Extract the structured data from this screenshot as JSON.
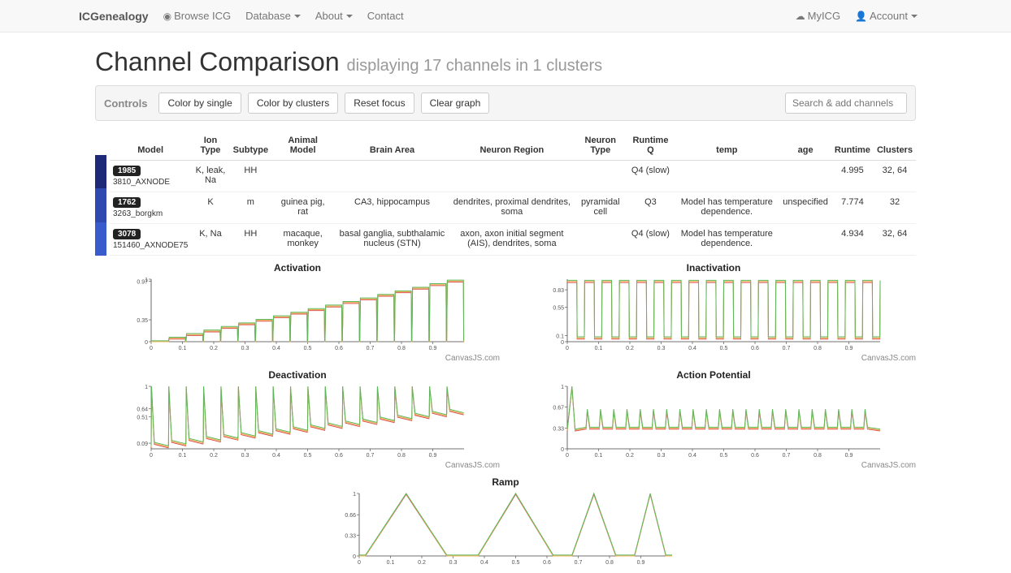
{
  "nav": {
    "brand": "ICGenealogy",
    "browse": "Browse ICG",
    "database": "Database",
    "about": "About",
    "contact": "Contact",
    "myicg": "MyICG",
    "account": "Account"
  },
  "title": "Channel Comparison",
  "subtitle": "displaying 17 channels in 1 clusters",
  "controls": {
    "label": "Controls",
    "color_single": "Color by single",
    "color_clusters": "Color by clusters",
    "reset": "Reset focus",
    "clear": "Clear graph",
    "search_placeholder": "Search & add channels"
  },
  "table": {
    "headers": [
      "Model",
      "Ion Type",
      "Subtype",
      "Animal Model",
      "Brain Area",
      "Neuron Region",
      "Neuron Type",
      "Runtime Q",
      "temp",
      "age",
      "Runtime",
      "Clusters"
    ],
    "rows": [
      {
        "color": "#1e2a78",
        "badge": "1985",
        "name": "3810_AXNODE",
        "ion": "K, leak, Na",
        "sub": "HH",
        "animal": "",
        "brain": "",
        "region": "",
        "ntype": "",
        "rq": "Q4 (slow)",
        "temp": "",
        "age": "",
        "rt": "4.995",
        "cl": "32, 64"
      },
      {
        "color": "#2f49b0",
        "badge": "1762",
        "name": "3263_borgkm",
        "ion": "K",
        "sub": "m",
        "animal": "guinea pig, rat",
        "brain": "CA3, hippocampus",
        "region": "dendrites, proximal dendrites, soma",
        "ntype": "pyramidal cell",
        "rq": "Q3",
        "temp": "Model has temperature dependence.",
        "age": "unspecified",
        "rt": "7.774",
        "cl": "32"
      },
      {
        "color": "#3a5bcc",
        "badge": "3078",
        "name": "151460_AXNODE75",
        "ion": "K, Na",
        "sub": "HH",
        "animal": "macaque, monkey",
        "brain": "basal ganglia, subthalamic nucleus (STN)",
        "region": "axon, axon initial segment (AIS), dendrites, soma",
        "ntype": "",
        "rq": "Q4 (slow)",
        "temp": "Model has temperature dependence.",
        "age": "",
        "rt": "4.934",
        "cl": "32, 64"
      }
    ]
  },
  "charts": {
    "watermark": "CanvasJS.com",
    "items": [
      {
        "title": "Activation"
      },
      {
        "title": "Inactivation"
      },
      {
        "title": "Deactivation"
      },
      {
        "title": "Action Potential"
      },
      {
        "title": "Ramp"
      }
    ]
  },
  "chart_data": [
    {
      "type": "line",
      "title": "Activation",
      "xlabel": "",
      "ylabel": "",
      "xlim": [
        0,
        1
      ],
      "ylim": [
        0,
        1
      ],
      "x_ticks": [
        0,
        0.1,
        0.2,
        0.3,
        0.4,
        0.5,
        0.6,
        0.7,
        0.8,
        0.9
      ],
      "y_ticks": [
        0,
        0.35,
        0.97,
        1
      ],
      "description": "Step responses rising with x; each of ~18 steps briefly drops to 0 then holds at a plateau that increases from ≈0 at x≈0.05 to ≈0.97 at x≈0.95; multiple near-overlapping series."
    },
    {
      "type": "line",
      "title": "Inactivation",
      "xlabel": "",
      "ylabel": "",
      "xlim": [
        0,
        1
      ],
      "ylim": [
        0,
        0.83
      ],
      "x_ticks": [
        0,
        0.1,
        0.2,
        0.3,
        0.4,
        0.5,
        0.6,
        0.7,
        0.8,
        0.9
      ],
      "y_ticks": [
        0,
        0.1,
        0.55,
        0.83
      ],
      "description": "Square-wave pattern: ~18 pulses alternating between a high plateau ≈0.80 and a low floor ≈0.05; amplitude roughly constant across x."
    },
    {
      "type": "line",
      "title": "Deactivation",
      "xlabel": "",
      "ylabel": "",
      "xlim": [
        0,
        1
      ],
      "ylim": [
        0.09,
        1
      ],
      "x_ticks": [
        0,
        0.1,
        0.2,
        0.3,
        0.4,
        0.5,
        0.6,
        0.7,
        0.8,
        0.9
      ],
      "y_ticks": [
        0.09,
        0.51,
        0.64,
        1
      ],
      "description": "Repeated sharp spikes (~18) to ≈1.0 that decay to a rising baseline, baseline ≈0.12 at x≈0.05 increasing to ≈0.60 at x≈0.95."
    },
    {
      "type": "line",
      "title": "Action Potential",
      "xlabel": "",
      "ylabel": "",
      "xlim": [
        0,
        1
      ],
      "ylim": [
        0,
        1
      ],
      "x_ticks": [
        0,
        0.1,
        0.2,
        0.3,
        0.4,
        0.5,
        0.6,
        0.7,
        0.8,
        0.9
      ],
      "y_ticks": [
        0,
        0.33,
        0.67,
        1
      ],
      "description": "Initial tall spike near x≈0.02 then a train of ~22 spikes with decreasing/steady height ≈0.55–0.7 on baseline ≈0.33."
    },
    {
      "type": "line",
      "title": "Ramp",
      "xlabel": "",
      "ylabel": "",
      "xlim": [
        0,
        1
      ],
      "ylim": [
        0,
        1
      ],
      "x_ticks": [
        0,
        0.1,
        0.2,
        0.3,
        0.4,
        0.5,
        0.6,
        0.7,
        0.8,
        0.9
      ],
      "y_ticks": [
        0,
        0.33,
        0.66,
        1
      ],
      "description": "Four triangular ramps of equal height ≈1.0 with decreasing width; approximate peak x-positions 0.15, 0.50, 0.75, 0.93; valleys return to ≈0."
    }
  ]
}
